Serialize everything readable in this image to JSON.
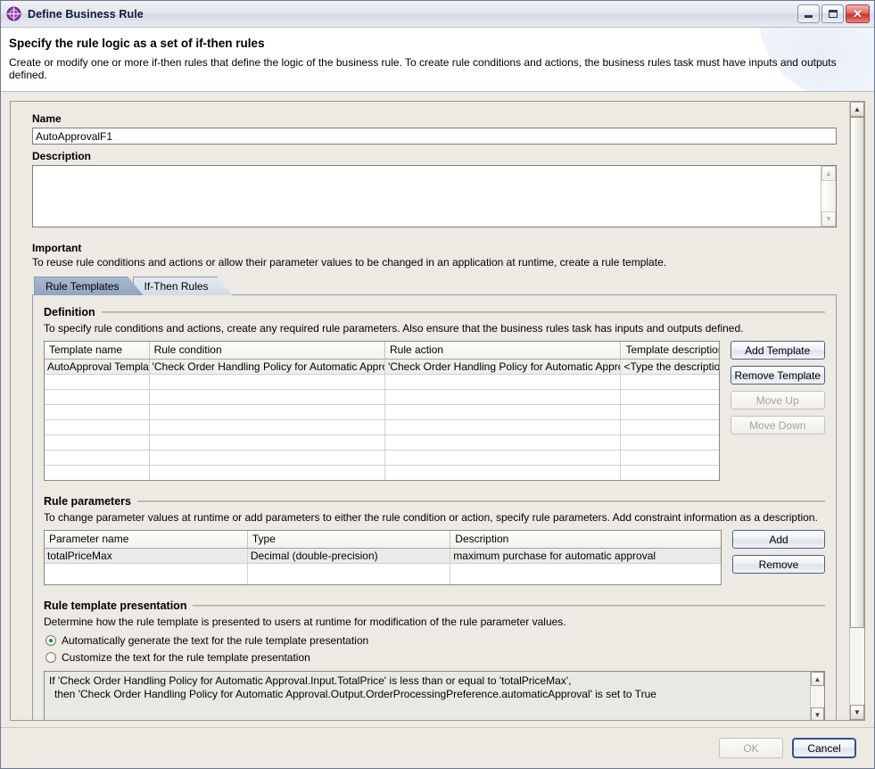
{
  "window": {
    "title": "Define Business Rule",
    "icon": "business-rule-icon",
    "minimize_label": "Minimize",
    "maximize_label": "Maximize",
    "close_label": "Close",
    "close_glyph": "✕"
  },
  "header": {
    "title": "Specify the rule logic as a set of if-then rules",
    "description": "Create or modify one or more if-then rules that define the logic of the business rule. To create rule conditions and actions, the business rules task must have inputs and outputs defined."
  },
  "form": {
    "name_label": "Name",
    "name_value": "AutoApprovalF1",
    "name_placeholder": "",
    "description_label": "Description",
    "description_value": "",
    "description_placeholder": ""
  },
  "important": {
    "title": "Important",
    "text": "To reuse rule conditions and actions or allow their parameter values to be changed in an application at runtime, create a rule template."
  },
  "tabs": [
    {
      "label": "Rule Templates",
      "active": true
    },
    {
      "label": "If-Then Rules",
      "active": false
    }
  ],
  "definition": {
    "title": "Definition",
    "description": "To specify rule conditions and actions, create any required rule parameters. Also ensure that the business rules task has inputs and outputs defined.",
    "columns": [
      "Template name",
      "Rule condition",
      "Rule action",
      "Template description"
    ],
    "rows": [
      [
        "AutoApproval Template",
        "'Check Order Handling Policy for Automatic Approval.Input.TotalPrice' is less than or equal to 'totalPriceMax'",
        "'Check Order Handling Policy for Automatic Approval.Output.OrderProcessingPreference.automaticApproval' is set to True",
        "<Type the description here>"
      ]
    ],
    "empty_row_count": 7,
    "buttons": [
      {
        "label": "Add Template",
        "enabled": true
      },
      {
        "label": "Remove Template",
        "enabled": true
      },
      {
        "label": "Move Up",
        "enabled": false
      },
      {
        "label": "Move Down",
        "enabled": false
      }
    ]
  },
  "parameters": {
    "title": "Rule parameters",
    "description": "To change parameter values at runtime or add parameters to either the rule condition or action, specify rule parameters. Add constraint information as a description.",
    "columns": [
      "Parameter name",
      "Type",
      "Description"
    ],
    "rows": [
      [
        "totalPriceMax",
        "Decimal (double-precision)",
        "maximum purchase for automatic approval"
      ]
    ],
    "empty_row_count": 1,
    "buttons": [
      {
        "label": "Add",
        "enabled": true
      },
      {
        "label": "Remove",
        "enabled": true
      }
    ]
  },
  "presentation": {
    "title": "Rule template presentation",
    "description": "Determine how the rule template is presented to users at runtime for modification of the rule parameter values.",
    "options": [
      {
        "label": "Automatically generate the text for the rule template presentation",
        "selected": true
      },
      {
        "label": "Customize the text for the rule template presentation",
        "selected": false
      }
    ],
    "text_line1": "If 'Check Order Handling Policy for Automatic Approval.Input.TotalPrice' is less than or equal to 'totalPriceMax',",
    "text_line2": "then 'Check Order Handling Policy for Automatic Approval.Output.OrderProcessingPreference.automaticApproval' is set to True"
  },
  "footer": {
    "ok_label": "OK",
    "ok_enabled": false,
    "cancel_label": "Cancel",
    "cancel_enabled": true
  },
  "scrollbar": {
    "up_glyph": "▲",
    "down_glyph": "▼"
  },
  "colors": {
    "accent_tab": "#90a5c0",
    "title_icon": "#8b2fa8",
    "close_button": "#c8322a",
    "radio_selected": "#1f8a1f"
  }
}
